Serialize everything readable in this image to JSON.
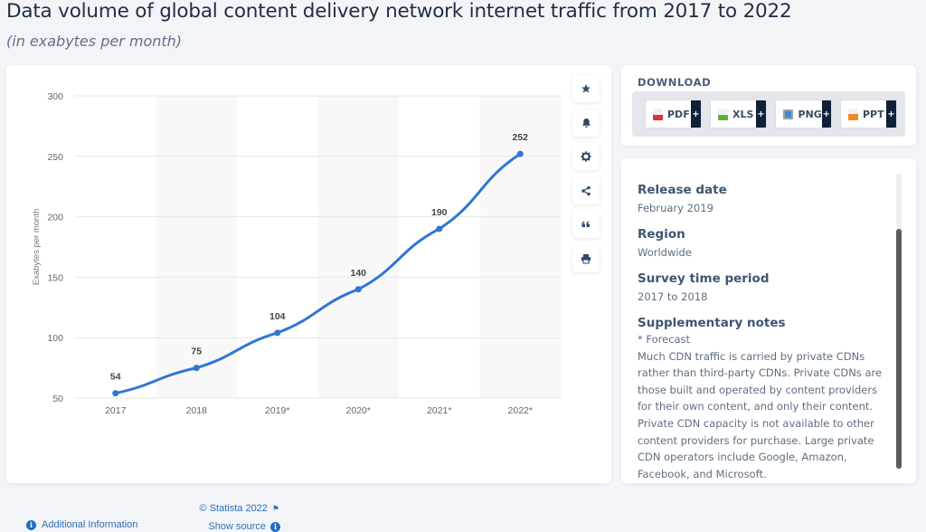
{
  "header": {
    "title": "Data volume of global content delivery network internet traffic from 2017 to 2022",
    "subtitle": "(in exabytes per month)"
  },
  "chart_data": {
    "type": "line",
    "title": "Data volume of global content delivery network internet traffic from 2017 to 2022",
    "subtitle": "(in exabytes per month)",
    "categories": [
      "2017",
      "2018",
      "2019*",
      "2020*",
      "2021*",
      "2022*"
    ],
    "series": [
      {
        "name": "Exabytes per month",
        "values": [
          54,
          75,
          104,
          140,
          190,
          252
        ],
        "color": "#2f76d2"
      }
    ],
    "data_labels": [
      "54",
      "75",
      "104",
      "140",
      "190",
      "252"
    ],
    "xlabel": "",
    "ylabel": "Exabytes per month",
    "ylim": [
      50,
      300
    ],
    "yticks": [
      50,
      100,
      150,
      200,
      250,
      300
    ],
    "ytick_labels": [
      "50",
      "100",
      "150",
      "200",
      "250",
      "300"
    ],
    "grid": true,
    "legend": "none"
  },
  "toolbar": {
    "buttons": [
      {
        "name": "favorite",
        "icon": "star-icon",
        "glyph": "★"
      },
      {
        "name": "notifications",
        "icon": "bell-icon",
        "glyph": "🔔"
      },
      {
        "name": "settings",
        "icon": "gear-icon",
        "glyph": "⚙"
      },
      {
        "name": "share",
        "icon": "share-icon",
        "glyph": "<"
      },
      {
        "name": "cite",
        "icon": "quote-icon",
        "glyph": "❝"
      },
      {
        "name": "print",
        "icon": "print-icon",
        "glyph": "⎙"
      }
    ]
  },
  "footer": {
    "additional_info": "Additional Information",
    "copyright": "© Statista 2022",
    "show_source": "Show source"
  },
  "download": {
    "title": "DOWNLOAD",
    "buttons": [
      {
        "label": "PDF",
        "color": "#d9343a"
      },
      {
        "label": "XLS",
        "color": "#58b43c"
      },
      {
        "label": "PNG",
        "color": "#4b86c9"
      },
      {
        "label": "PPT",
        "color": "#ef8a2c"
      }
    ],
    "plus": "+"
  },
  "info": {
    "release_date_label": "Release date",
    "release_date": "February 2019",
    "region_label": "Region",
    "region": "Worldwide",
    "survey_period_label": "Survey time period",
    "survey_period": "2017 to 2018",
    "notes_label": "Supplementary notes",
    "notes_forecast": "* Forecast",
    "notes_text": "Much CDN traffic is carried by private CDNs rather than third-party CDNs. Private CDNs are those built and operated by content providers for their own content, and only their content. Private CDN capacity is not available to other content providers for purchase. Large private CDN operators include Google, Amazon, Facebook, and Microsoft."
  }
}
